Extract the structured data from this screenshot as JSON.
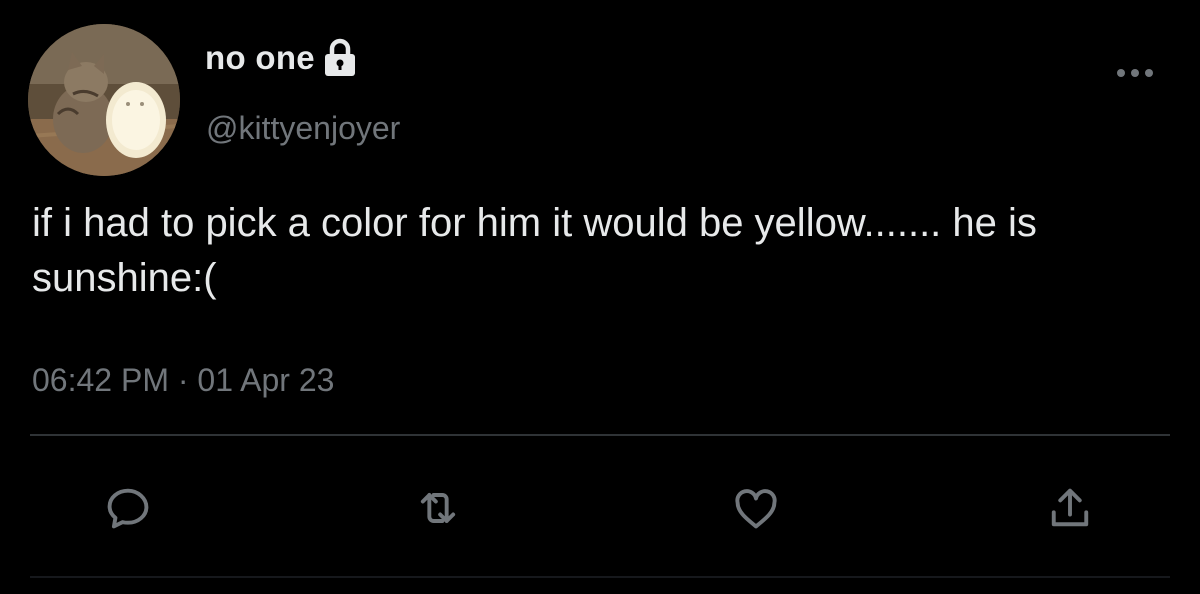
{
  "tweet": {
    "display_name": "no one",
    "handle": "@kittyenjoyer",
    "text": "if i had to pick a color for him it would be yellow....... he is sunshine:(",
    "time": "06:42 PM",
    "separator": "·",
    "date": "01 Apr 23",
    "protected": true
  },
  "avatar": {
    "icon": "kitten-with-lamp-photo"
  },
  "actions": [
    {
      "name": "reply",
      "icon": "speech-bubble-icon"
    },
    {
      "name": "retweet",
      "icon": "retweet-arrows-icon"
    },
    {
      "name": "like",
      "icon": "heart-icon"
    },
    {
      "name": "share",
      "icon": "share-upload-icon"
    }
  ],
  "colors": {
    "background": "#000000",
    "primary_text": "#e7e9ea",
    "secondary_text": "#71767b",
    "divider": "#2f3336"
  }
}
